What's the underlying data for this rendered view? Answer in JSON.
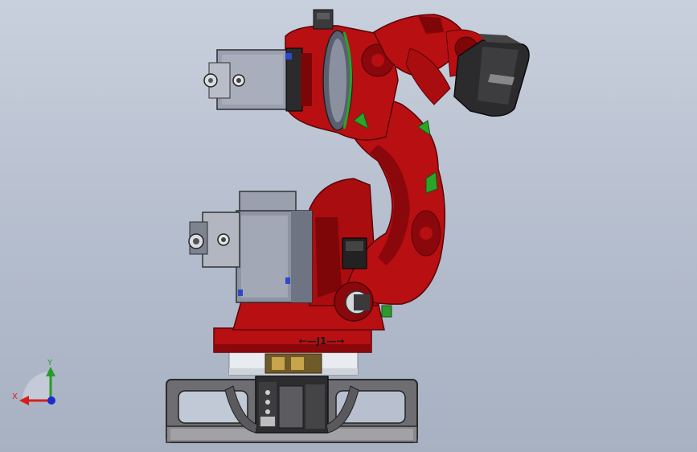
{
  "scene": {
    "joint_label": "←—J1—→",
    "arm_marking": "",
    "head_marking": ""
  },
  "triad": {
    "x_label": "X",
    "y_label": "Y",
    "x_color": "#d41f1f",
    "y_color": "#2a9a2a",
    "z_color": "#1c2ad0"
  },
  "colors": {
    "robot_red": "#b80f12",
    "robot_red_dark": "#7e0608",
    "motor_grey": "#8e94a3",
    "base_grey": "#6f6f73"
  }
}
